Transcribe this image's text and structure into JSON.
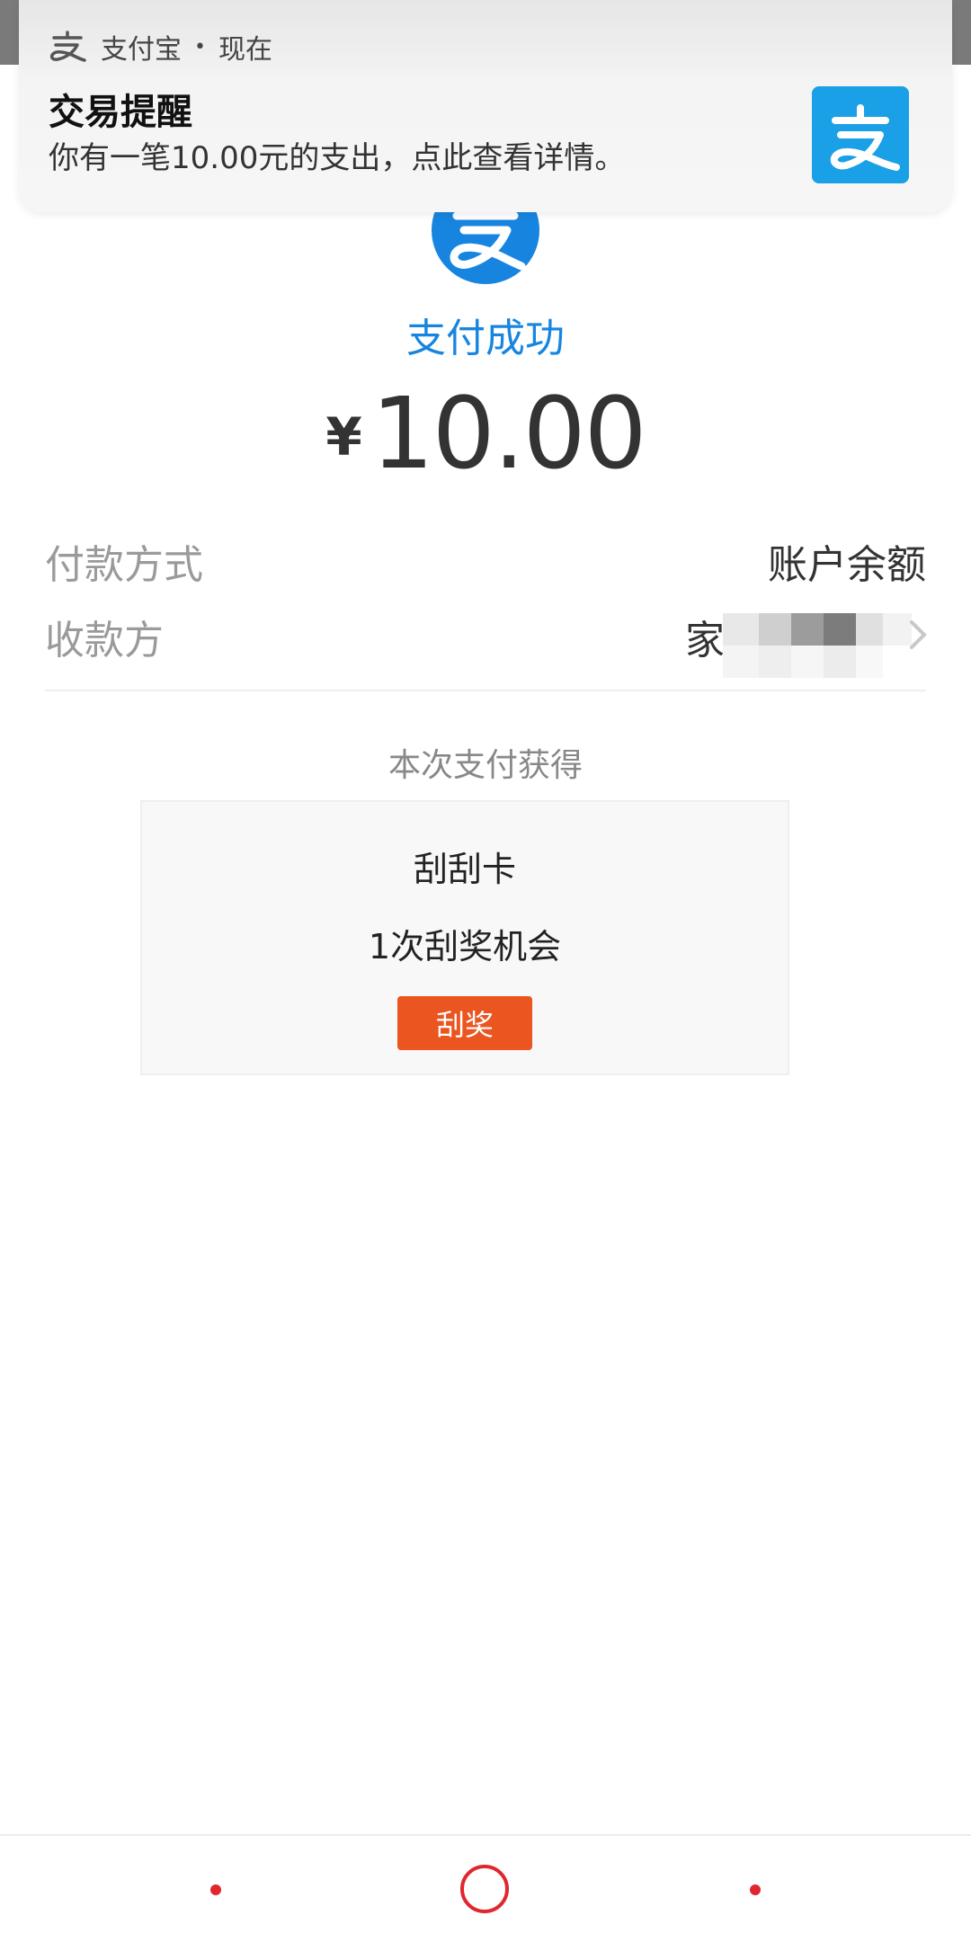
{
  "notification": {
    "app_name": "支付宝",
    "separator": "•",
    "time": "现在",
    "title": "交易提醒",
    "body": "你有一笔10.00元的支出，点此查看详情。",
    "app_icon": "alipay-icon",
    "brand_color": "#1aa0e6"
  },
  "result": {
    "status": "支付成功",
    "currency_symbol": "¥",
    "amount": "10.00",
    "status_color": "#1785e0"
  },
  "details": {
    "payment_method_label": "付款方式",
    "payment_method_value": "账户余额",
    "payee_label": "收款方",
    "payee_value": "家果"
  },
  "reward": {
    "section_title": "本次支付获得",
    "card_name": "刮刮卡",
    "card_desc": "1次刮奖机会",
    "button_label": "刮奖",
    "button_color": "#ea5520"
  },
  "nav": {
    "accent_color": "#e0262e",
    "icons": [
      "back-icon",
      "home-icon",
      "recent-apps-icon"
    ]
  }
}
